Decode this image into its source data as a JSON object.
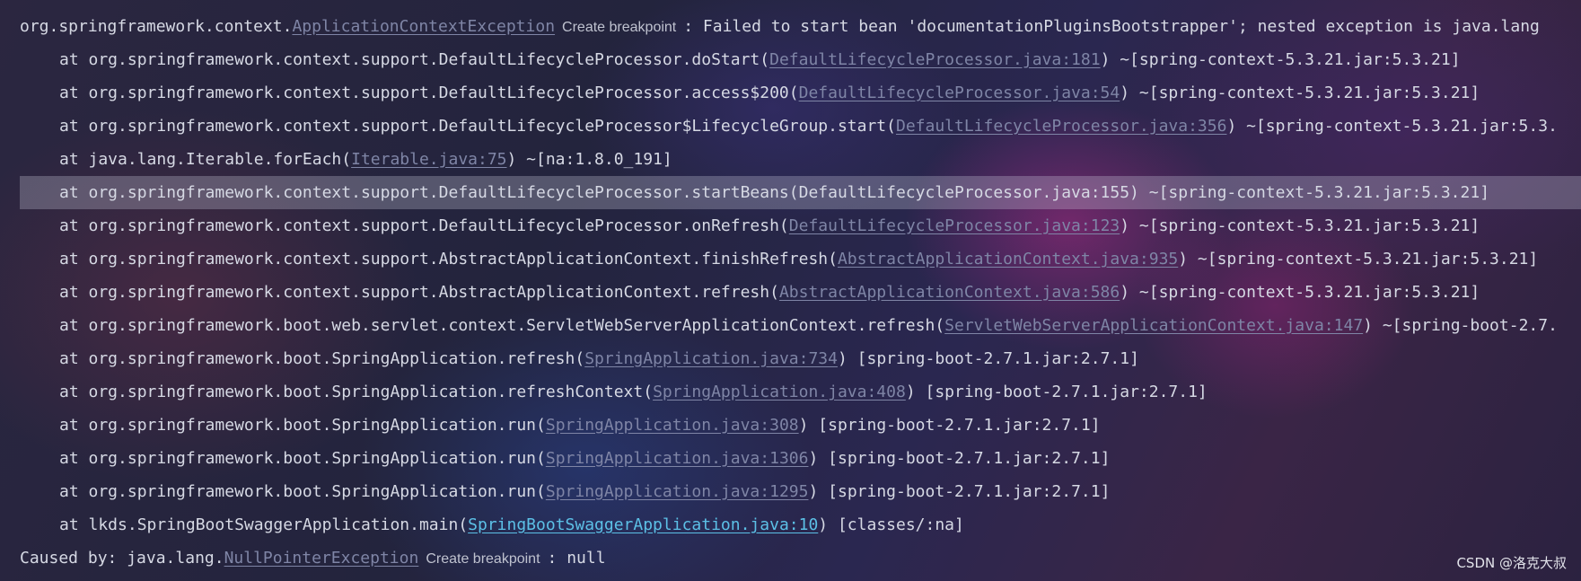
{
  "first_line": {
    "prefix": "org.springframework.context.",
    "exception_link": "ApplicationContextException",
    "breakpoint_label": "Create breakpoint",
    "message": ": Failed to start bean 'documentationPluginsBootstrapper'; nested exception is java.lang"
  },
  "frames": [
    {
      "prefix": "at org.springframework.context.support.DefaultLifecycleProcessor.doStart(",
      "link": "DefaultLifecycleProcessor.java:181",
      "suffix": ") ~[spring-context-5.3.21.jar:5.3.21]"
    },
    {
      "prefix": "at org.springframework.context.support.DefaultLifecycleProcessor.access$200(",
      "link": "DefaultLifecycleProcessor.java:54",
      "suffix": ") ~[spring-context-5.3.21.jar:5.3.21]"
    },
    {
      "prefix": "at org.springframework.context.support.DefaultLifecycleProcessor$LifecycleGroup.start(",
      "link": "DefaultLifecycleProcessor.java:356",
      "suffix": ") ~[spring-context-5.3.21.jar:5.3."
    },
    {
      "prefix": "at java.lang.Iterable.forEach(",
      "link": "Iterable.java:75",
      "suffix": ") ~[na:1.8.0_191]"
    },
    {
      "prefix": "at org.springframework.context.support.DefaultLifecycleProcessor.startBeans(DefaultLifecycleProcessor.java:155) ~[spring-context-5.3.21.jar:5.3.21]",
      "link": "",
      "suffix": ""
    },
    {
      "prefix": "at org.springframework.context.support.DefaultLifecycleProcessor.onRefresh(",
      "link": "DefaultLifecycleProcessor.java:123",
      "suffix": ") ~[spring-context-5.3.21.jar:5.3.21]"
    },
    {
      "prefix": "at org.springframework.context.support.AbstractApplicationContext.finishRefresh(",
      "link": "AbstractApplicationContext.java:935",
      "suffix": ") ~[spring-context-5.3.21.jar:5.3.21]"
    },
    {
      "prefix": "at org.springframework.context.support.AbstractApplicationContext.refresh(",
      "link": "AbstractApplicationContext.java:586",
      "suffix": ") ~[spring-context-5.3.21.jar:5.3.21]"
    },
    {
      "prefix": "at org.springframework.boot.web.servlet.context.ServletWebServerApplicationContext.refresh(",
      "link": "ServletWebServerApplicationContext.java:147",
      "suffix": ") ~[spring-boot-2.7."
    },
    {
      "prefix": "at org.springframework.boot.SpringApplication.refresh(",
      "link": "SpringApplication.java:734",
      "suffix": ") [spring-boot-2.7.1.jar:2.7.1]"
    },
    {
      "prefix": "at org.springframework.boot.SpringApplication.refreshContext(",
      "link": "SpringApplication.java:408",
      "suffix": ") [spring-boot-2.7.1.jar:2.7.1]"
    },
    {
      "prefix": "at org.springframework.boot.SpringApplication.run(",
      "link": "SpringApplication.java:308",
      "suffix": ") [spring-boot-2.7.1.jar:2.7.1]"
    },
    {
      "prefix": "at org.springframework.boot.SpringApplication.run(",
      "link": "SpringApplication.java:1306",
      "suffix": ") [spring-boot-2.7.1.jar:2.7.1]"
    },
    {
      "prefix": "at org.springframework.boot.SpringApplication.run(",
      "link": "SpringApplication.java:1295",
      "suffix": ") [spring-boot-2.7.1.jar:2.7.1]"
    },
    {
      "prefix": "at lkds.SpringBootSwaggerApplication.main(",
      "link": "SpringBootSwaggerApplication.java:10",
      "suffix": ") [classes/:na]"
    }
  ],
  "caused_by": {
    "prefix": "Caused by: java.lang.",
    "exception_link": "NullPointerException",
    "breakpoint_label": "Create breakpoint",
    "message": ": null"
  },
  "watermark": "CSDN @洛克大叔"
}
